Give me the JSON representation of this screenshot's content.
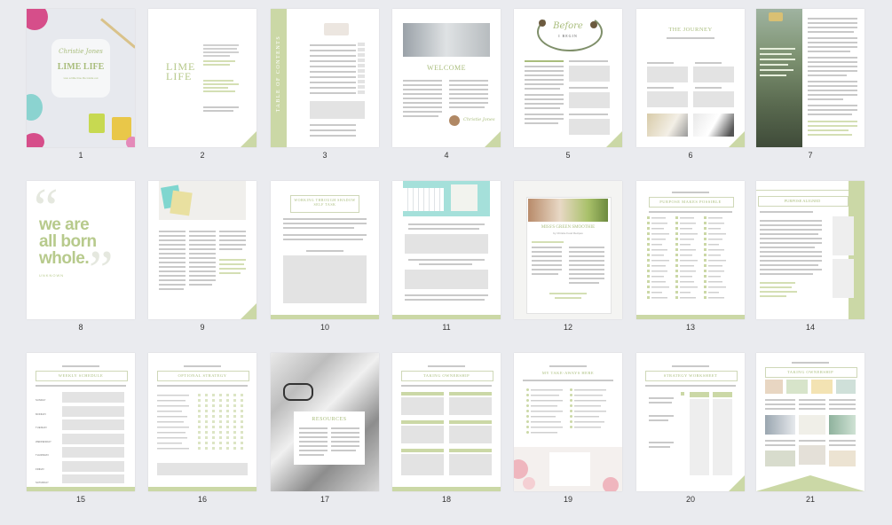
{
  "pages": [
    {
      "n": "1",
      "kind": "cover",
      "script1": "Christie Jones",
      "heading": "LIME LIFE",
      "sub": "Live a little lime life inside out"
    },
    {
      "n": "2",
      "kind": "title-page",
      "heading": "LIME",
      "heading2": "LIFE"
    },
    {
      "n": "3",
      "kind": "toc",
      "side": "TABLE OF CONTENTS"
    },
    {
      "n": "4",
      "kind": "welcome",
      "heading": "WELCOME",
      "sign": "Christie Jones"
    },
    {
      "n": "5",
      "kind": "before",
      "script1": "Before",
      "script2": "I BEGIN"
    },
    {
      "n": "6",
      "kind": "journey",
      "heading": "THE JOURNEY"
    },
    {
      "n": "7",
      "kind": "photo-quote"
    },
    {
      "n": "8",
      "kind": "quote",
      "line1": "we are",
      "line2": "all born",
      "line3": "whole.",
      "author": "UNKNOWN"
    },
    {
      "n": "9",
      "kind": "article"
    },
    {
      "n": "10",
      "kind": "framed-title",
      "heading": "WORKING THROUGH SHADOW SELF TASK"
    },
    {
      "n": "11",
      "kind": "keyboard"
    },
    {
      "n": "12",
      "kind": "recipe",
      "heading": "MISS'S GREEN SMOOTHIE",
      "sub": "by Christie Food Recipes"
    },
    {
      "n": "13",
      "kind": "checklist",
      "heading": "PURPOSE MAKES POSSIBLE"
    },
    {
      "n": "14",
      "kind": "sidebar-text",
      "heading": "PURPOSE ALIGNED"
    },
    {
      "n": "15",
      "kind": "schedule",
      "heading": "WEEKLY SCHEDULE",
      "days": [
        "SUNDAY",
        "MONDAY",
        "TUESDAY",
        "WEDNESDAY",
        "THURSDAY",
        "FRIDAY",
        "SATURDAY"
      ]
    },
    {
      "n": "16",
      "kind": "tracker",
      "heading": "OPTIONAL STRATEGY"
    },
    {
      "n": "17",
      "kind": "resources",
      "heading": "RESOURCES"
    },
    {
      "n": "18",
      "kind": "ownership",
      "heading": "TAKING OWNERSHIP"
    },
    {
      "n": "19",
      "kind": "flower-list",
      "heading": "MY TAKE-AWAYS HERE"
    },
    {
      "n": "20",
      "kind": "worksheet",
      "heading": "STRATEGY WORKSHEET"
    },
    {
      "n": "21",
      "kind": "collage",
      "heading": "TAKING OWNERSHIP"
    }
  ],
  "colors": {
    "accent": "#cbd8a6",
    "accent_text": "#a9bd7c",
    "page_bg": "#ffffff",
    "canvas": "#eaebef"
  }
}
